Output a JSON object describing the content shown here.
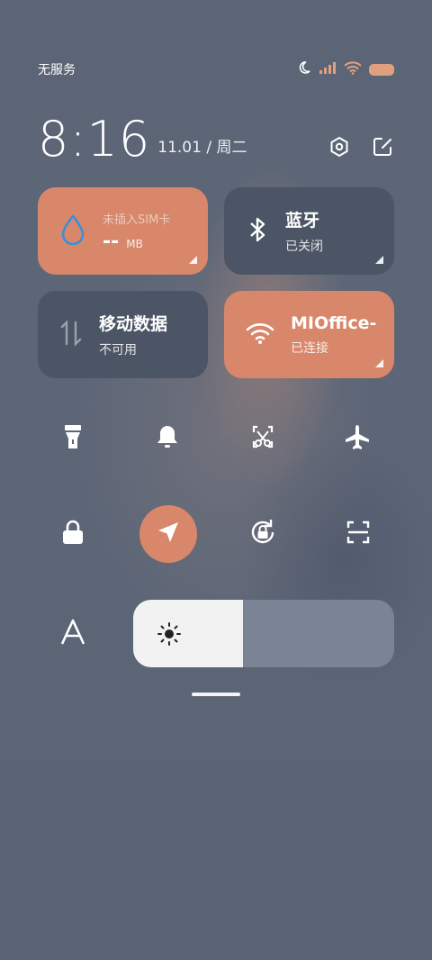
{
  "status_bar": {
    "carrier": "无服务",
    "icons": [
      "moon-icon",
      "signal-icon",
      "wifi-icon",
      "battery-icon"
    ]
  },
  "clock": {
    "time": "8:16",
    "date": "11.01 / 周二"
  },
  "tiles": {
    "sim": {
      "label": "未插入SIM卡",
      "value": "--",
      "unit": "MB"
    },
    "bluetooth": {
      "title": "蓝牙",
      "status": "已关闭"
    },
    "mobile_data": {
      "title": "移动数据",
      "status": "不可用"
    },
    "wifi": {
      "title": "MIOffice-",
      "status": "已连接"
    }
  },
  "quick_toggles": [
    "flashlight-icon",
    "bell-icon",
    "screenshot-icon",
    "airplane-icon",
    "lock-icon",
    "location-icon",
    "rotation-lock-icon",
    "scan-icon"
  ],
  "brightness": {
    "level": 0.42
  },
  "colors": {
    "accent": "#d8876a",
    "tile_gray": "#4b5565",
    "background": "#5a6475"
  }
}
